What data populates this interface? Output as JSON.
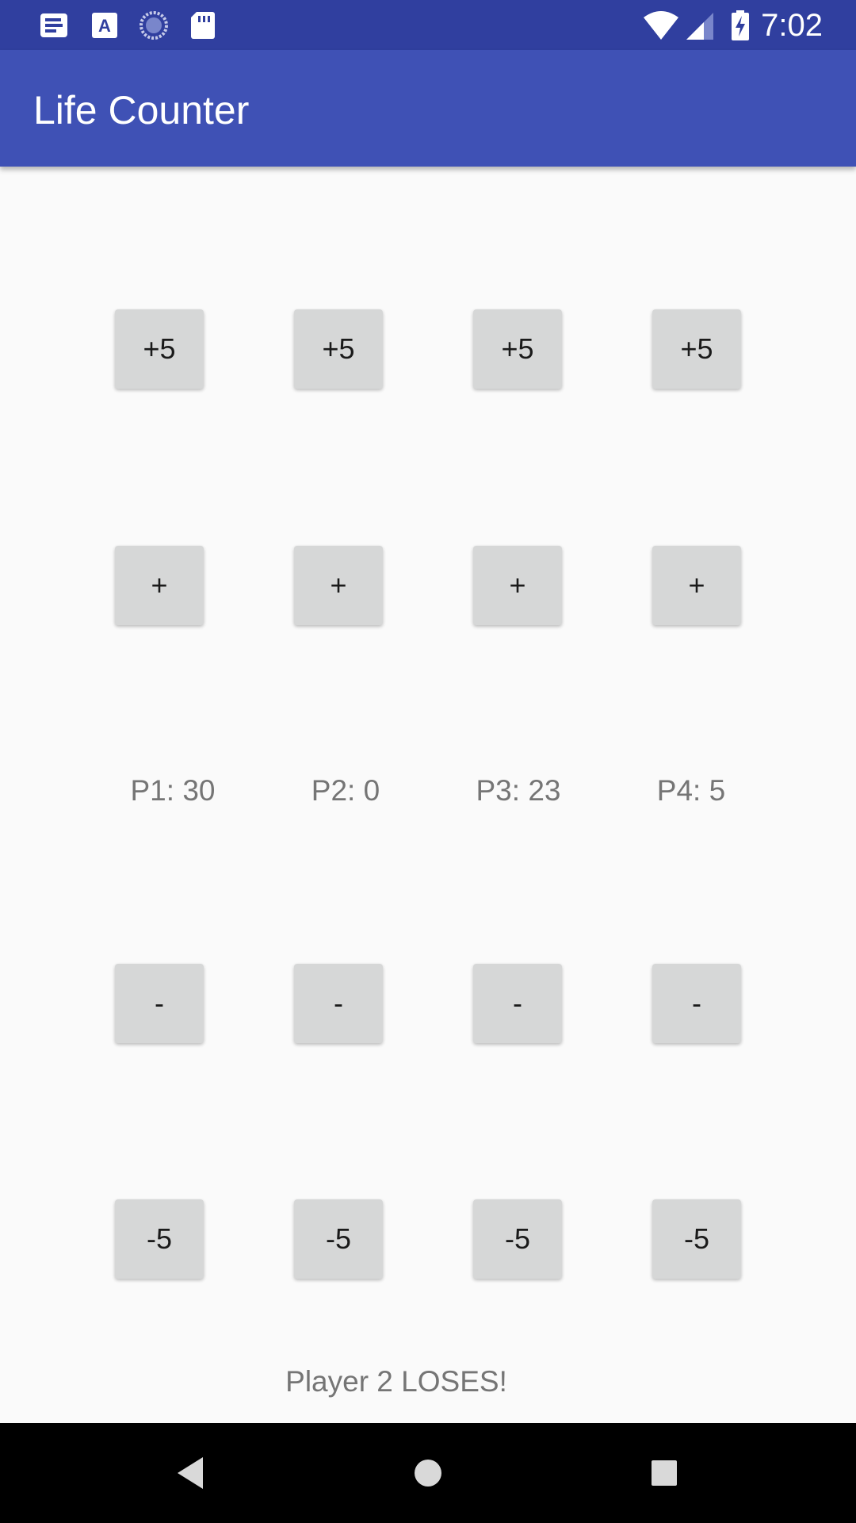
{
  "status_bar": {
    "time": "7:02",
    "left_icons": [
      "news-icon",
      "text-a-icon",
      "sync-icon",
      "sd-card-icon"
    ],
    "right_icons": [
      "wifi-icon",
      "signal-icon",
      "battery-charging-icon"
    ],
    "background": "#303f9f"
  },
  "app_bar": {
    "title": "Life Counter",
    "background": "#3f51b5"
  },
  "players": [
    {
      "plus5": "+5",
      "plus1": "+",
      "life": "P1: 30",
      "minus1": "-",
      "minus5": "-5"
    },
    {
      "plus5": "+5",
      "plus1": "+",
      "life": "P2: 0",
      "minus1": "-",
      "minus5": "-5"
    },
    {
      "plus5": "+5",
      "plus1": "+",
      "life": "P3: 23",
      "minus1": "-",
      "minus5": "-5"
    },
    {
      "plus5": "+5",
      "plus1": "+",
      "life": "P4: 5",
      "minus1": "-",
      "minus5": "-5"
    }
  ],
  "status_message": "Player 2 LOSES!",
  "nav_bar": {
    "buttons": [
      "back-icon",
      "home-icon",
      "recents-icon"
    ]
  }
}
